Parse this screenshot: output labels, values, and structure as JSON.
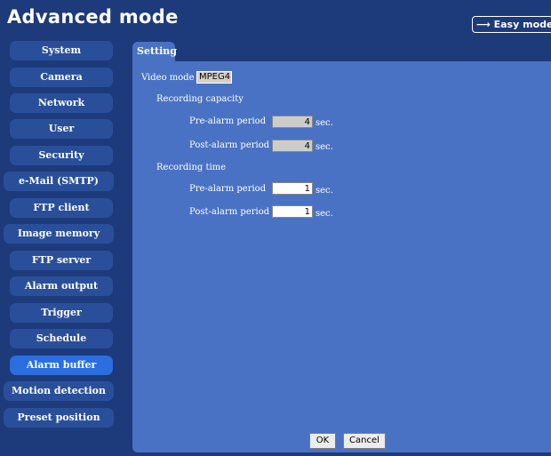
{
  "header": {
    "title": "Advanced mode",
    "easy_mode_label": "Easy mode",
    "easy_mode_icon": "arrow-right-icon"
  },
  "sidebar": {
    "items": [
      {
        "label": "System"
      },
      {
        "label": "Camera"
      },
      {
        "label": "Network"
      },
      {
        "label": "User"
      },
      {
        "label": "Security"
      },
      {
        "label": "e-Mail (SMTP)"
      },
      {
        "label": "FTP client"
      },
      {
        "label": "Image memory"
      },
      {
        "label": "FTP server"
      },
      {
        "label": "Alarm output"
      },
      {
        "label": "Trigger"
      },
      {
        "label": "Schedule"
      },
      {
        "label": "Alarm buffer",
        "active": true
      },
      {
        "label": "Motion detection"
      },
      {
        "label": "Preset position"
      }
    ]
  },
  "tabs": [
    {
      "label": "Setting"
    }
  ],
  "form": {
    "video_mode_label": "Video mode",
    "video_mode_value": "MPEG4",
    "recording_capacity_label": "Recording capacity",
    "capacity_pre_label": "Pre-alarm period",
    "capacity_pre_value": "4",
    "capacity_post_label": "Post-alarm period",
    "capacity_post_value": "4",
    "recording_time_label": "Recording time",
    "time_pre_label": "Pre-alarm period",
    "time_pre_value": "1",
    "time_post_label": "Post-alarm period",
    "time_post_value": "1",
    "unit": "sec."
  },
  "buttons": {
    "ok": "OK",
    "cancel": "Cancel"
  },
  "colors": {
    "header_bg": "#1d3a7a",
    "panel_bg": "#4a72c4",
    "active_nav": "#2a6ee0"
  }
}
